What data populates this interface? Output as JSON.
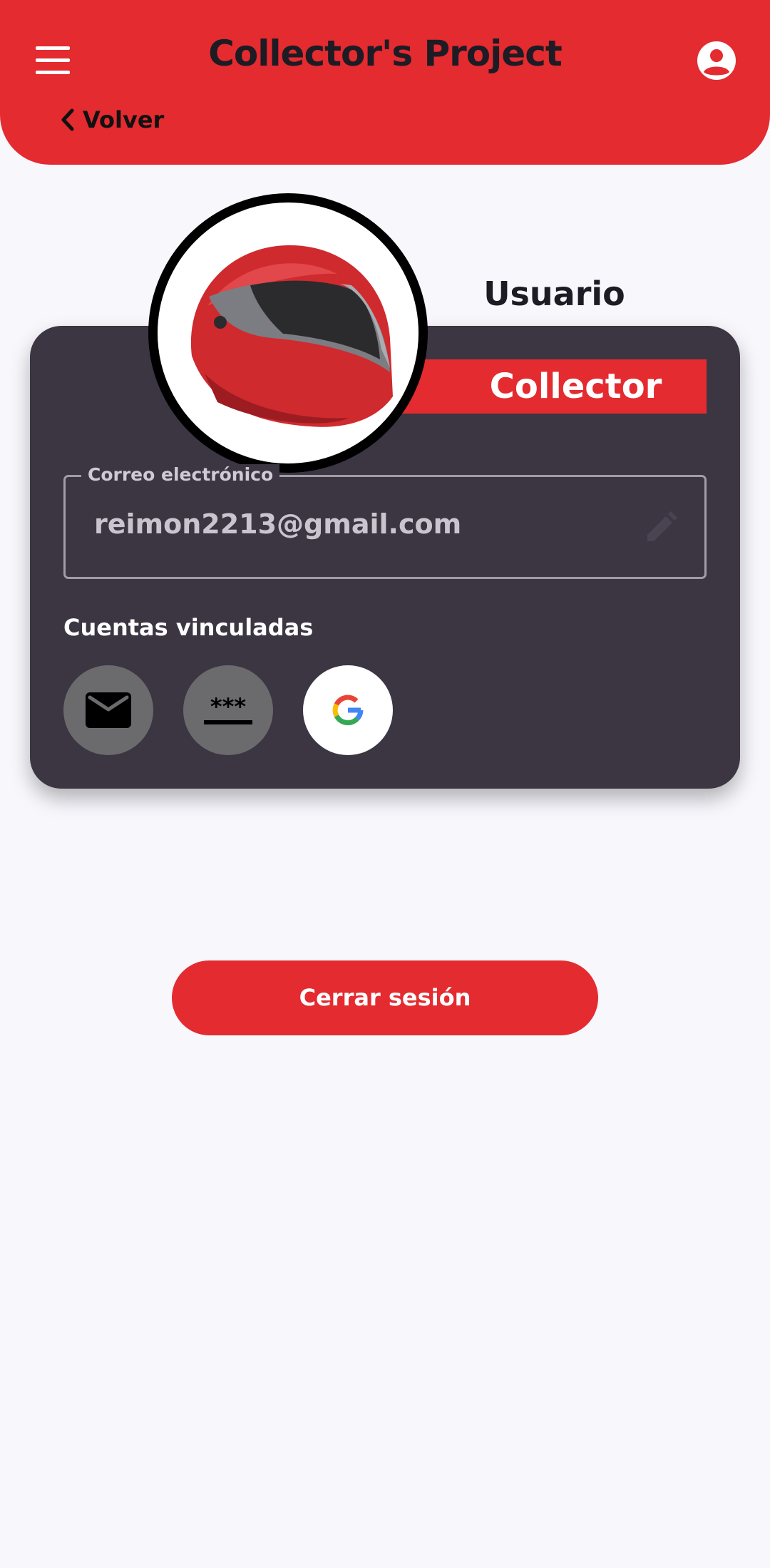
{
  "theme": {
    "accent": "#e32b30",
    "card": "#3c3643",
    "background": "#f7f7fc"
  },
  "header": {
    "title": "Collector's Project",
    "back_label": "Volver",
    "menu_icon": "menu-icon",
    "account_icon": "account-circle-icon",
    "back_icon": "chevron-left-icon"
  },
  "profile": {
    "username": "Usuario",
    "role": "Collector",
    "avatar_icon": "red-helmet-avatar"
  },
  "email_field": {
    "label": "Correo electrónico",
    "value": "reimon2213@gmail.com",
    "edit_icon": "pencil-icon"
  },
  "linked_accounts": {
    "title": "Cuentas vinculadas",
    "items": [
      {
        "icon": "email-icon",
        "linked": false
      },
      {
        "icon": "password-icon",
        "linked": false
      },
      {
        "icon": "google-icon",
        "linked": true
      }
    ]
  },
  "actions": {
    "logout_label": "Cerrar sesión"
  }
}
